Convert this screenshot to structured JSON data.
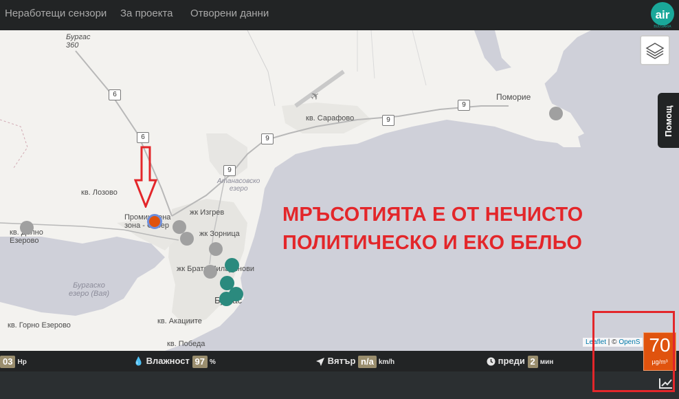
{
  "nav": {
    "items": [
      {
        "label": "Неработещи сензори"
      },
      {
        "label": "За проекта"
      },
      {
        "label": "Отворени данни"
      }
    ],
    "logo_text": "air",
    "logo_subtext": "BULGARIA"
  },
  "map": {
    "labels": {
      "burgas_360": "Бургас\n360",
      "pomorie": "Поморие",
      "sarafovo": "кв. Сарафово",
      "atanasovsko": "Атанасовско\nезеро",
      "lozovo": "кв. Лозово",
      "promishlena": "Промишлена\nзона - Север",
      "izgrev": "жк Изгрев",
      "zornitsa": "жк Зорница",
      "dolno_ezerovo": "кв. Долно\nЕзерово",
      "bratya": "жк Братя Миладинови",
      "burgas": "Бургас",
      "burgasko": "Бургаско\nезеро (Вая)",
      "gorno_ezerovo": "кв. Горно Езерово",
      "akatsiite": "кв. Акациите",
      "pobeda": "кв. Победа"
    },
    "highways": [
      "360",
      "6",
      "6",
      "9",
      "9",
      "9",
      "9"
    ],
    "help_label": "Помощ",
    "caption_line1": "МРЪСОТИЯТА Е ОТ НЕЧИСТО",
    "caption_line2": "ПОЛИТИЧЕСКО И ЕКО БЕЛЬО",
    "attribution_leaflet": "Leaflet",
    "attribution_sep": " | © ",
    "attribution_osm": "OpenS",
    "colors": {
      "caption": "#e3262a",
      "sensor_offline": "#a0a0a0",
      "sensor_good": "#2b8a7e",
      "sensor_selected": "#e0530e"
    }
  },
  "stats": {
    "pressure_value": "03",
    "pressure_unit": "Hp",
    "humidity_label": "Влажност",
    "humidity_value": "97",
    "humidity_unit": "%",
    "wind_label": "Вятър",
    "wind_value": "n/a",
    "wind_unit": "km/h",
    "time_label": "преди",
    "time_value": "2",
    "time_unit": "мин"
  },
  "aqi": {
    "value": "70",
    "unit": "µg/m³"
  }
}
